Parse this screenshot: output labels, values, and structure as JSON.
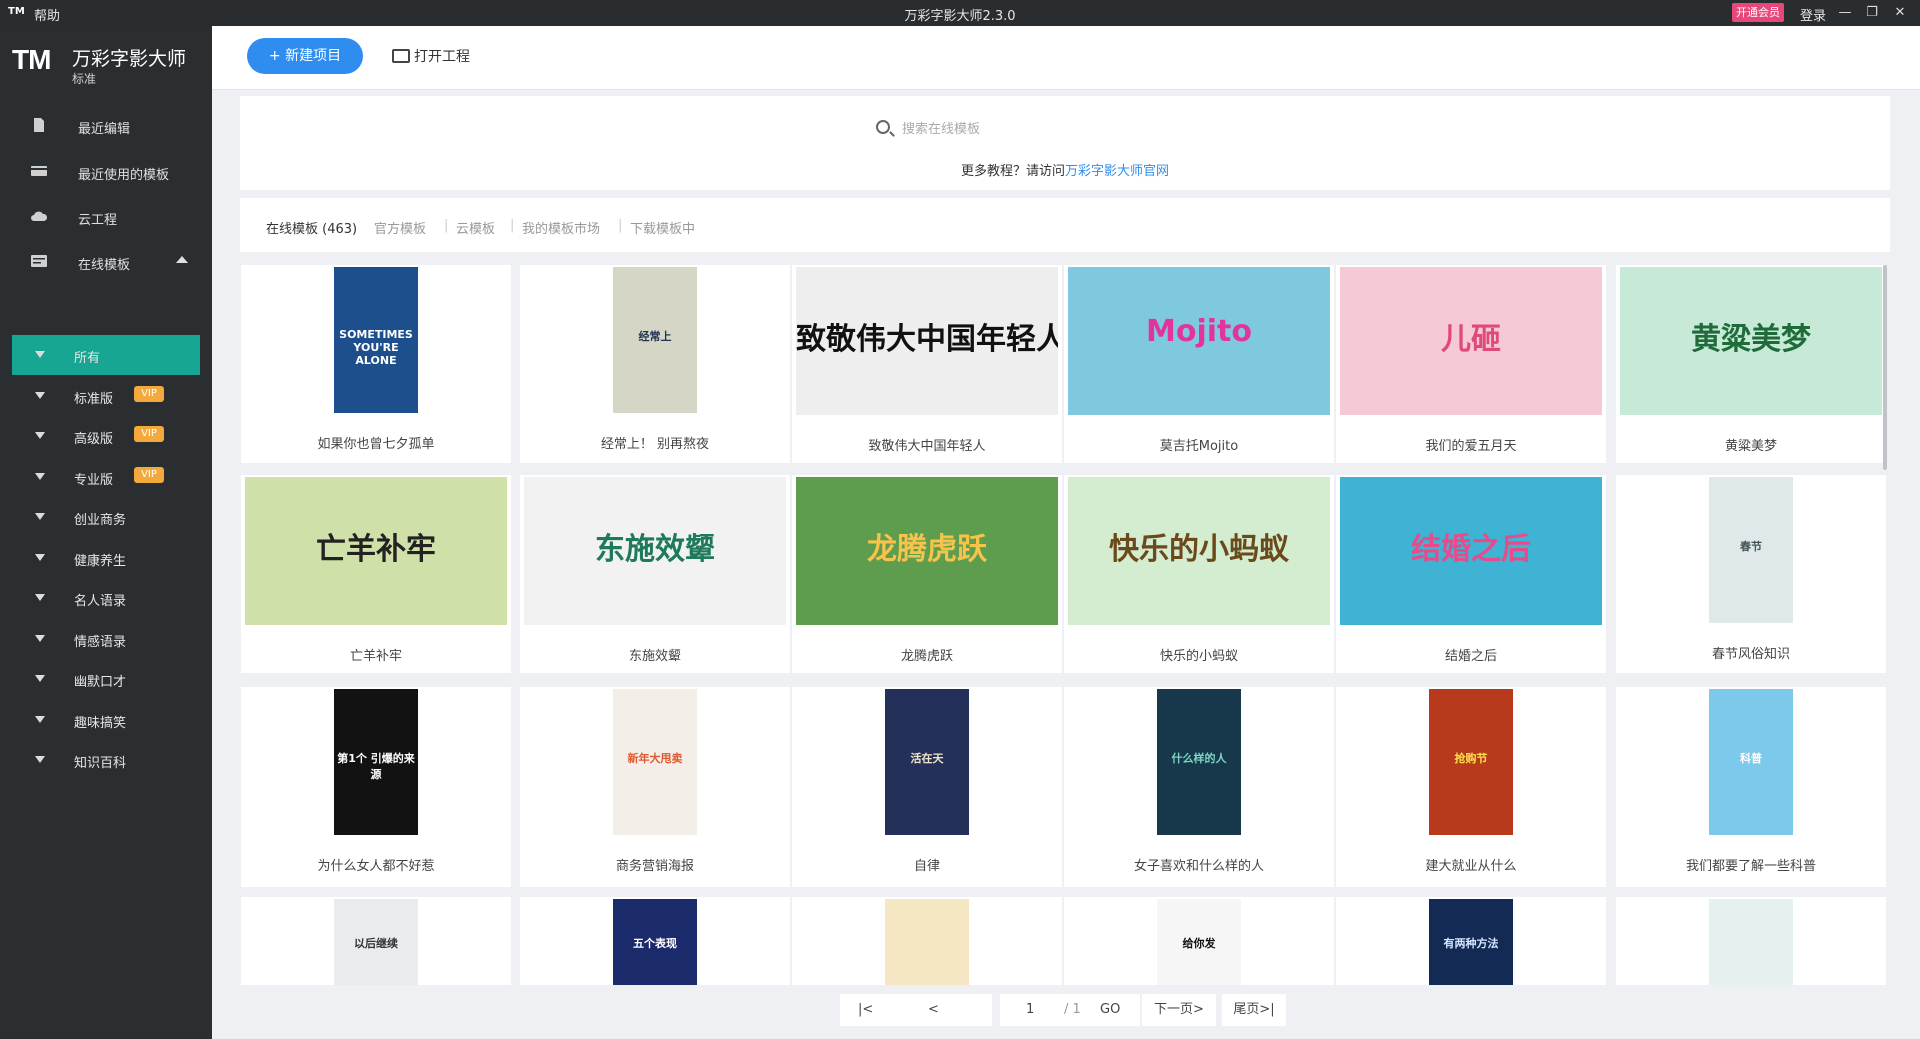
{
  "titlebar": {
    "app_icon": "TM",
    "help": "帮助",
    "title": "万彩字影大师2.3.0",
    "vip": "开通会员",
    "login": "登录",
    "minimize": "—",
    "restore": "❐",
    "close": "✕"
  },
  "sidebar": {
    "logo": "TM",
    "app_name": "万彩字影大师",
    "edition": "标准",
    "nav": [
      {
        "label": "最近编辑",
        "icon": "document-icon"
      },
      {
        "label": "最近使用的模板",
        "icon": "card-icon"
      },
      {
        "label": "云工程",
        "icon": "cloud-icon"
      },
      {
        "label": "在线模板",
        "icon": "template-icon"
      }
    ],
    "subnav": [
      {
        "label": "所有",
        "badge": ""
      },
      {
        "label": "标准版",
        "badge": "VIP"
      },
      {
        "label": "高级版",
        "badge": "VIP"
      },
      {
        "label": "专业版",
        "badge": "VIP"
      },
      {
        "label": "创业商务",
        "badge": ""
      },
      {
        "label": "健康养生",
        "badge": ""
      },
      {
        "label": "名人语录",
        "badge": ""
      },
      {
        "label": "情感语录",
        "badge": ""
      },
      {
        "label": "幽默口才",
        "badge": ""
      },
      {
        "label": "趣味搞笑",
        "badge": ""
      },
      {
        "label": "知识百科",
        "badge": ""
      }
    ]
  },
  "toolbar": {
    "new_project": "+ 新建项目",
    "open_project": "打开工程"
  },
  "search": {
    "placeholder": "搜索在线模板",
    "tutorial_prefix": "更多教程？请访问",
    "tutorial_link": "万彩字影大师官网"
  },
  "tabs": [
    {
      "label": "在线模板 (463)"
    },
    {
      "label": "官方模板"
    },
    {
      "label": "云模板"
    },
    {
      "label": "我的模板市场"
    },
    {
      "label": "下载模板中"
    }
  ],
  "colors": {
    "accent": "#2e8def",
    "active": "#16a692",
    "sidebar": "#2b2e31",
    "vip_badge": "#f3a93b"
  },
  "cards": [
    {
      "caption": "如果你也曾七夕孤单",
      "thumb_text": "SOMETIMES YOU'RE ALONE",
      "bg": "#1d4f8c",
      "fg": "#ffffff",
      "tall": true
    },
    {
      "caption": "经常上！ 别再熬夜",
      "thumb_text": "经常上",
      "bg": "#d5d6c5",
      "fg": "#223355",
      "tall": true
    },
    {
      "caption": "致敬伟大中国年轻人",
      "thumb_text": "致敬伟大中国年轻人",
      "bg": "#eeeeee",
      "fg": "#111111",
      "tall": false
    },
    {
      "caption": "莫吉托Mojito",
      "thumb_text": "Mojito",
      "bg": "#7fc9e0",
      "fg": "#e2349a",
      "tall": false
    },
    {
      "caption": "我们的爱五月天",
      "thumb_text": "儿砸",
      "bg": "#f6c9d6",
      "fg": "#e04a7a",
      "tall": false
    },
    {
      "caption": "黄粱美梦",
      "thumb_text": "黄粱美梦",
      "bg": "#c7ead8",
      "fg": "#1f6b3a",
      "tall": false
    },
    {
      "caption": "亡羊补牢",
      "thumb_text": "亡羊补牢",
      "bg": "#cfe0a8",
      "fg": "#222222",
      "tall": false
    },
    {
      "caption": "东施效颦",
      "thumb_text": "东施效颦",
      "bg": "#f2f2f2",
      "fg": "#1e7a5a",
      "tall": false
    },
    {
      "caption": "龙腾虎跃",
      "thumb_text": "龙腾虎跃",
      "bg": "#5e9d4d",
      "fg": "#f6c34b",
      "tall": false
    },
    {
      "caption": "快乐的小蚂蚁",
      "thumb_text": "快乐的小蚂蚁",
      "bg": "#d4ecd0",
      "fg": "#6a4a1a",
      "tall": false
    },
    {
      "caption": "结婚之后",
      "thumb_text": "结婚之后",
      "bg": "#3fb3d4",
      "fg": "#e84a8a",
      "tall": false
    },
    {
      "caption": "春节风俗知识",
      "thumb_text": "春节",
      "bg": "#dfe9e9",
      "fg": "#445555",
      "tall": true
    },
    {
      "caption": "为什么女人都不好惹",
      "thumb_text": "第1个 引爆的来源",
      "bg": "#121212",
      "fg": "#ffffff",
      "tall": true
    },
    {
      "caption": "商务营销海报",
      "thumb_text": "新年大甩卖",
      "bg": "#f3eee8",
      "fg": "#e05a30",
      "tall": true
    },
    {
      "caption": "自律",
      "thumb_text": "活在天",
      "bg": "#24305a",
      "fg": "#f0e6c8",
      "tall": true
    },
    {
      "caption": "女子喜欢和什么样的人",
      "thumb_text": "什么样的人",
      "bg": "#17384a",
      "fg": "#7ad6c2",
      "tall": true
    },
    {
      "caption": "建大就业从什么",
      "thumb_text": "抢购节",
      "bg": "#b73a1c",
      "fg": "#ffe04a",
      "tall": true
    },
    {
      "caption": "我们都要了解一些科普",
      "thumb_text": "科普",
      "bg": "#7cc9ec",
      "fg": "#ffffff",
      "tall": true
    },
    {
      "caption": "",
      "thumb_text": "以后继续",
      "bg": "#e9ecee",
      "fg": "#333333",
      "tall": true
    },
    {
      "caption": "",
      "thumb_text": "五个表现",
      "bg": "#1b2a6b",
      "fg": "#ffffff",
      "tall": true
    },
    {
      "caption": "",
      "thumb_text": "",
      "bg": "#f5e7c4",
      "fg": "#333333",
      "tall": true
    },
    {
      "caption": "",
      "thumb_text": "给你发",
      "bg": "#f6f6f6",
      "fg": "#111111",
      "tall": true
    },
    {
      "caption": "",
      "thumb_text": "有两种方法",
      "bg": "#132a55",
      "fg": "#d8e6ff",
      "tall": true
    },
    {
      "caption": "",
      "thumb_text": "",
      "bg": "#e4f1ee",
      "fg": "#333333",
      "tall": true
    }
  ],
  "pager": {
    "first": "|<",
    "prev": "<",
    "page": "1",
    "of": "/ 1",
    "go": "GO",
    "next": "下一页>",
    "last": "尾页>|"
  }
}
